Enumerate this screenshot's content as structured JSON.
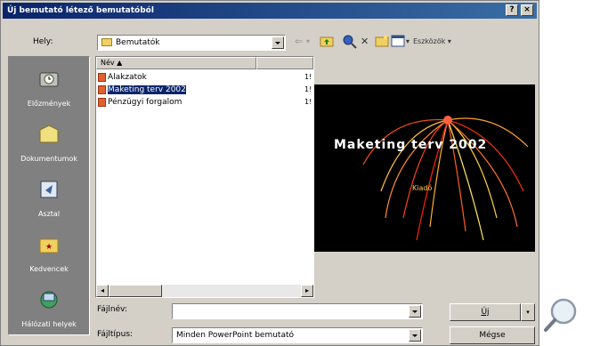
{
  "window": {
    "title": "Új bemutató létező bemutatóból",
    "help": "?",
    "close": "×"
  },
  "location": {
    "label": "Hely:",
    "value": "Bemutatók"
  },
  "toolbar": {
    "tools_label": "Eszközök"
  },
  "places": [
    {
      "label": "Előzmények",
      "icon": "history-icon"
    },
    {
      "label": "Dokumentumok",
      "icon": "documents-folder-icon"
    },
    {
      "label": "Asztal",
      "icon": "desktop-icon"
    },
    {
      "label": "Kedvencek",
      "icon": "favorites-folder-icon"
    },
    {
      "label": "Hálózati helyek",
      "icon": "network-places-icon"
    }
  ],
  "files": {
    "col_name": "Név",
    "items": [
      {
        "name": "Alakzatok",
        "date": "1!",
        "selected": false
      },
      {
        "name": "Maketing terv 2002",
        "date": "1!",
        "selected": true
      },
      {
        "name": "Pénzügyi forgalom",
        "date": "1!",
        "selected": false
      }
    ]
  },
  "preview": {
    "title": "Maketing terv 2002",
    "subtitle": "Kiadó"
  },
  "filename": {
    "label": "Fájlnév:",
    "value": ""
  },
  "filetype": {
    "label": "Fájltípus:",
    "value": "Minden PowerPoint bemutató"
  },
  "buttons": {
    "open": "Új",
    "cancel": "Mégse"
  },
  "colors": {
    "title_start": "#0a246a",
    "title_end": "#3a6ea5",
    "face": "#d4d0c8",
    "selection": "#0a246a"
  }
}
